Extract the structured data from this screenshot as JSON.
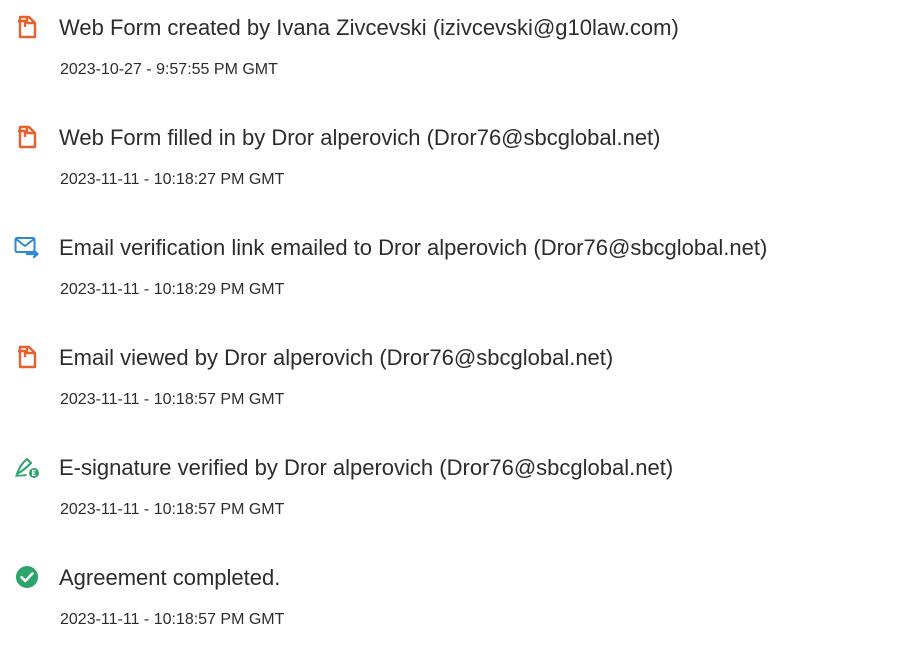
{
  "events": [
    {
      "icon": "document-icon",
      "icon_color": "#e8602c",
      "description": "Web Form created by Ivana Zivcevski (izivcevski@g10law.com)",
      "timestamp": "2023-10-27 - 9:57:55 PM GMT"
    },
    {
      "icon": "document-icon",
      "icon_color": "#e8602c",
      "description": "Web Form filled in by Dror alperovich (Dror76@sbcglobal.net)",
      "timestamp": "2023-11-11 - 10:18:27 PM GMT"
    },
    {
      "icon": "email-send-icon",
      "icon_color": "#2a8ad6",
      "description": "Email verification link emailed to Dror alperovich (Dror76@sbcglobal.net)",
      "timestamp": "2023-11-11 - 10:18:29 PM GMT"
    },
    {
      "icon": "document-icon",
      "icon_color": "#e8602c",
      "description": "Email viewed by Dror alperovich (Dror76@sbcglobal.net)",
      "timestamp": "2023-11-11 - 10:18:57 PM GMT"
    },
    {
      "icon": "e-signature-icon",
      "icon_color": "#2ba56b",
      "description": "E-signature verified by Dror alperovich (Dror76@sbcglobal.net)",
      "timestamp": "2023-11-11 - 10:18:57 PM GMT"
    },
    {
      "icon": "check-circle-icon",
      "icon_color": "#2ba56b",
      "description": "Agreement completed.",
      "timestamp": "2023-11-11 - 10:18:57 PM GMT"
    }
  ]
}
